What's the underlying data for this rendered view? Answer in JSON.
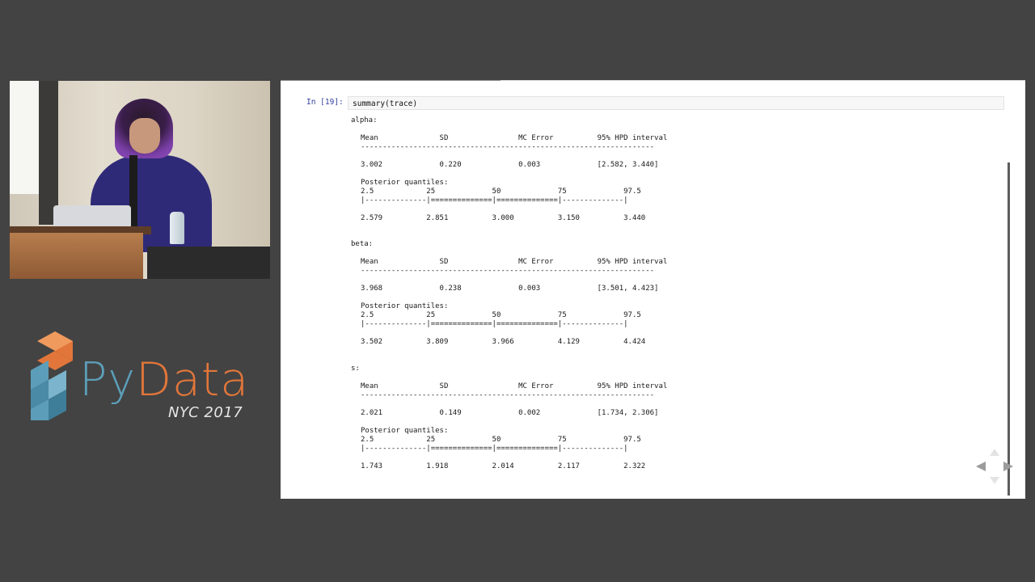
{
  "logo": {
    "brand_py": "Py",
    "brand_data": "Data",
    "city": "NYC 2017"
  },
  "notebook": {
    "prompt": "In [19]:",
    "code": "summary(trace)",
    "blocks": [
      {
        "name": "alpha:",
        "header": "Mean              SD                MC Error          95% HPD interval",
        "dashes": "-------------------------------------------------------------------",
        "values": "3.002             0.220             0.003             [2.582, 3.440]",
        "quantiles_label": "Posterior quantiles:",
        "quantiles_header": "2.5            25             50             75             97.5",
        "quantiles_bar": "|--------------|==============|==============|--------------|",
        "quantiles_values": "2.579          2.851          3.000          3.150          3.440"
      },
      {
        "name": "beta:",
        "header": "Mean              SD                MC Error          95% HPD interval",
        "dashes": "-------------------------------------------------------------------",
        "values": "3.968             0.238             0.003             [3.501, 4.423]",
        "quantiles_label": "Posterior quantiles:",
        "quantiles_header": "2.5            25             50             75             97.5",
        "quantiles_bar": "|--------------|==============|==============|--------------|",
        "quantiles_values": "3.502          3.809          3.966          4.129          4.424"
      },
      {
        "name": "s:",
        "header": "Mean              SD                MC Error          95% HPD interval",
        "dashes": "-------------------------------------------------------------------",
        "values": "2.021             0.149             0.002             [1.734, 2.306]",
        "quantiles_label": "Posterior quantiles:",
        "quantiles_header": "2.5            25             50             75             97.5",
        "quantiles_bar": "|--------------|==============|==============|--------------|",
        "quantiles_values": "1.743          1.918          2.014          2.117          2.322"
      }
    ]
  },
  "colors": {
    "background": "#434343",
    "slide": "#ffffff",
    "prompt": "#303f9f",
    "logo_orange": "#e2763a",
    "logo_blue": "#5c9eb9"
  },
  "icons": [
    "nav-left-arrow-icon",
    "nav-right-arrow-icon",
    "nav-up-arrow-icon",
    "nav-down-arrow-icon"
  ]
}
